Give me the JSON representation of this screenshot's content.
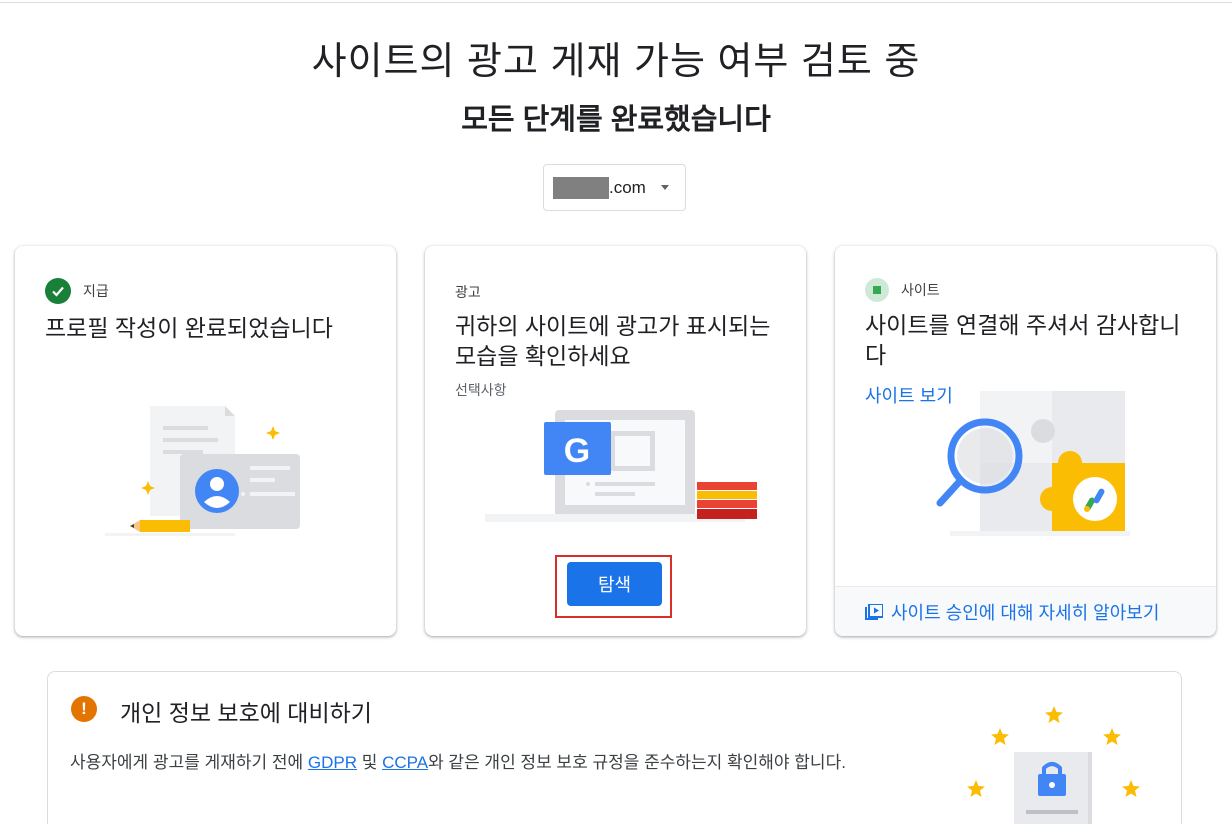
{
  "page": {
    "title": "사이트의 광고 게재 가능 여부 검토 중",
    "subtitle": "모든 단계를 완료했습니다"
  },
  "site_selector": {
    "domain_suffix": ".com"
  },
  "cards": {
    "payment": {
      "label": "지급",
      "heading": "프로필 작성이 완료되었습니다",
      "icon": "check-circle-icon"
    },
    "ads": {
      "label": "광고",
      "heading": "귀하의 사이트에 광고가 표시되는 모습을 확인하세요",
      "optional": "선택사항",
      "button": "탐색"
    },
    "site": {
      "label": "사이트",
      "heading": "사이트를 연결해 주셔서 감사합니다",
      "link": "사이트 보기",
      "footer": "사이트 승인에 대해 자세히 알아보기"
    }
  },
  "privacy": {
    "title": "개인 정보 보호에 대비하기",
    "text_before": "사용자에게 광고를 게재하기 전에 ",
    "gdpr": "GDPR",
    "and": " 및 ",
    "ccpa": "CCPA",
    "text_after": "와 같은 개인 정보 보호 규정을 준수하는지 확인해야 합니다."
  },
  "colors": {
    "accent": "#1a73e8",
    "success": "#188038",
    "warning": "#e37400",
    "highlight_border": "#d93025"
  }
}
